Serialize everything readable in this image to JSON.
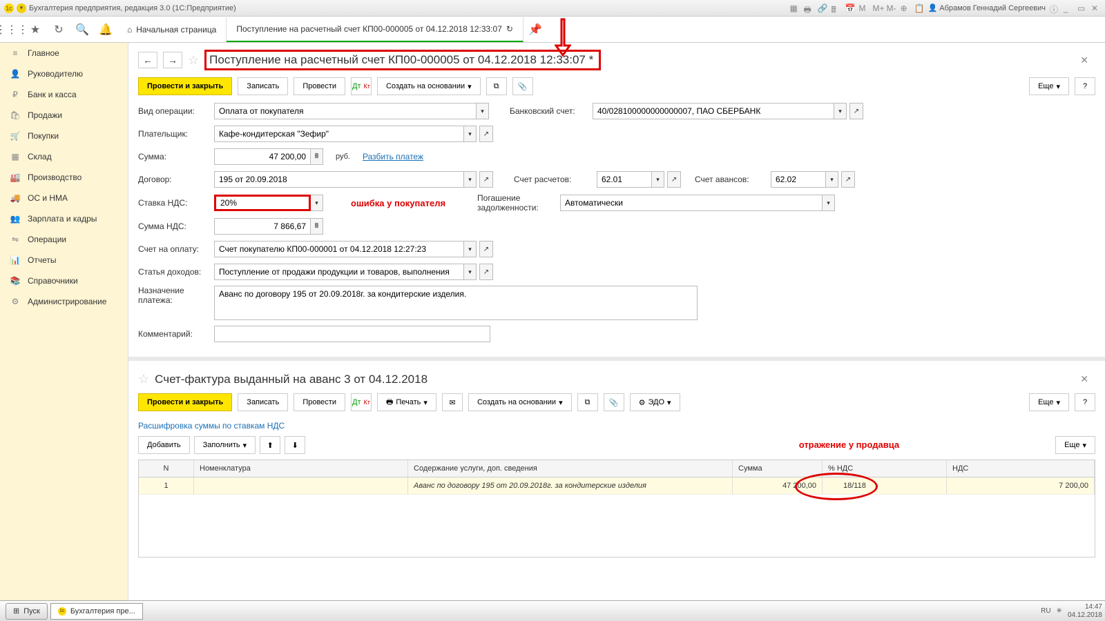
{
  "titlebar": {
    "app": "Бухгалтерия предприятия, редакция 3.0  (1С:Предприятие)",
    "user": "Абрамов Геннадий Сергеевич"
  },
  "tabs": {
    "home": "Начальная страница",
    "doc": "Поступление на расчетный счет КП00-000005 от 04.12.2018 12:33:07"
  },
  "sidebar": [
    {
      "icon": "≡",
      "label": "Главное"
    },
    {
      "icon": "👤",
      "label": "Руководителю"
    },
    {
      "icon": "₽",
      "label": "Банк и касса"
    },
    {
      "icon": "🛍",
      "label": "Продажи"
    },
    {
      "icon": "🛒",
      "label": "Покупки"
    },
    {
      "icon": "▦",
      "label": "Склад"
    },
    {
      "icon": "🏭",
      "label": "Производство"
    },
    {
      "icon": "🚚",
      "label": "ОС и НМА"
    },
    {
      "icon": "👥",
      "label": "Зарплата и кадры"
    },
    {
      "icon": "⇋",
      "label": "Операции"
    },
    {
      "icon": "📊",
      "label": "Отчеты"
    },
    {
      "icon": "📚",
      "label": "Справочники"
    },
    {
      "icon": "⚙",
      "label": "Администрирование"
    }
  ],
  "doc": {
    "title": "Поступление на расчетный счет КП00-000005 от 04.12.2018 12:33:07 *",
    "actions": {
      "post_close": "Провести и закрыть",
      "save": "Записать",
      "post": "Провести",
      "create_based": "Создать на основании",
      "more": "Еще",
      "help": "?"
    },
    "fields": {
      "op_type_l": "Вид операции:",
      "op_type_v": "Оплата от покупателя",
      "bank_acc_l": "Банковский счет:",
      "bank_acc_v": "40/028100000000000007, ПАО СБЕРБАНК",
      "payer_l": "Плательщик:",
      "payer_v": "Кафе-кондитерская \"Зефир\"",
      "sum_l": "Сумма:",
      "sum_v": "47 200,00",
      "rub": "руб.",
      "split": "Разбить платеж",
      "contract_l": "Договор:",
      "contract_v": "195 от 20.09.2018",
      "settle_acc_l": "Счет расчетов:",
      "settle_acc_v": "62.01",
      "adv_acc_l": "Счет авансов:",
      "adv_acc_v": "62.02",
      "vat_rate_l": "Ставка НДС:",
      "vat_rate_v": "20%",
      "anno_buyer": "ошибка у покупателя",
      "debt_l": "Погашение задолженности:",
      "debt_v": "Автоматически",
      "vat_sum_l": "Сумма НДС:",
      "vat_sum_v": "7 866,67",
      "invoice_l": "Счет на оплату:",
      "invoice_v": "Счет покупателю КП00-000001 от 04.12.2018 12:27:23",
      "income_l": "Статья доходов:",
      "income_v": "Поступление от продажи продукции и товаров, выполнения",
      "purpose_l": "Назначение платежа:",
      "purpose_v": "Аванс по договору 195 от 20.09.2018г. за кондитерские изделия.",
      "comment_l": "Комментарий:",
      "comment_v": ""
    }
  },
  "sf": {
    "title": "Счет-фактура выданный на аванс 3 от 04.12.2018",
    "actions": {
      "post_close": "Провести и закрыть",
      "save": "Записать",
      "post": "Провести",
      "print": "Печать",
      "create_based": "Создать на основании",
      "edo": "ЭДО",
      "more": "Еще",
      "help": "?"
    },
    "sublink": "Расшифровка суммы по ставкам НДС",
    "grid_actions": {
      "add": "Добавить",
      "fill": "Заполнить"
    },
    "anno_seller": "отражение у продавца",
    "columns": {
      "n": "N",
      "nom": "Номенклатура",
      "desc": "Содержание услуги, доп. сведения",
      "sum": "Сумма",
      "vat_pct": "% НДС",
      "vat": "НДС"
    },
    "row": {
      "n": "1",
      "desc": "Аванс по договору 195 от 20.09.2018г. за кондитерские изделия",
      "sum": "47 200,00",
      "vat_pct": "18/118",
      "vat": "7 200,00"
    }
  },
  "taskbar": {
    "start": "Пуск",
    "app": "Бухгалтерия пре...",
    "lang": "RU",
    "time": "14:47",
    "date": "04.12.2018"
  }
}
